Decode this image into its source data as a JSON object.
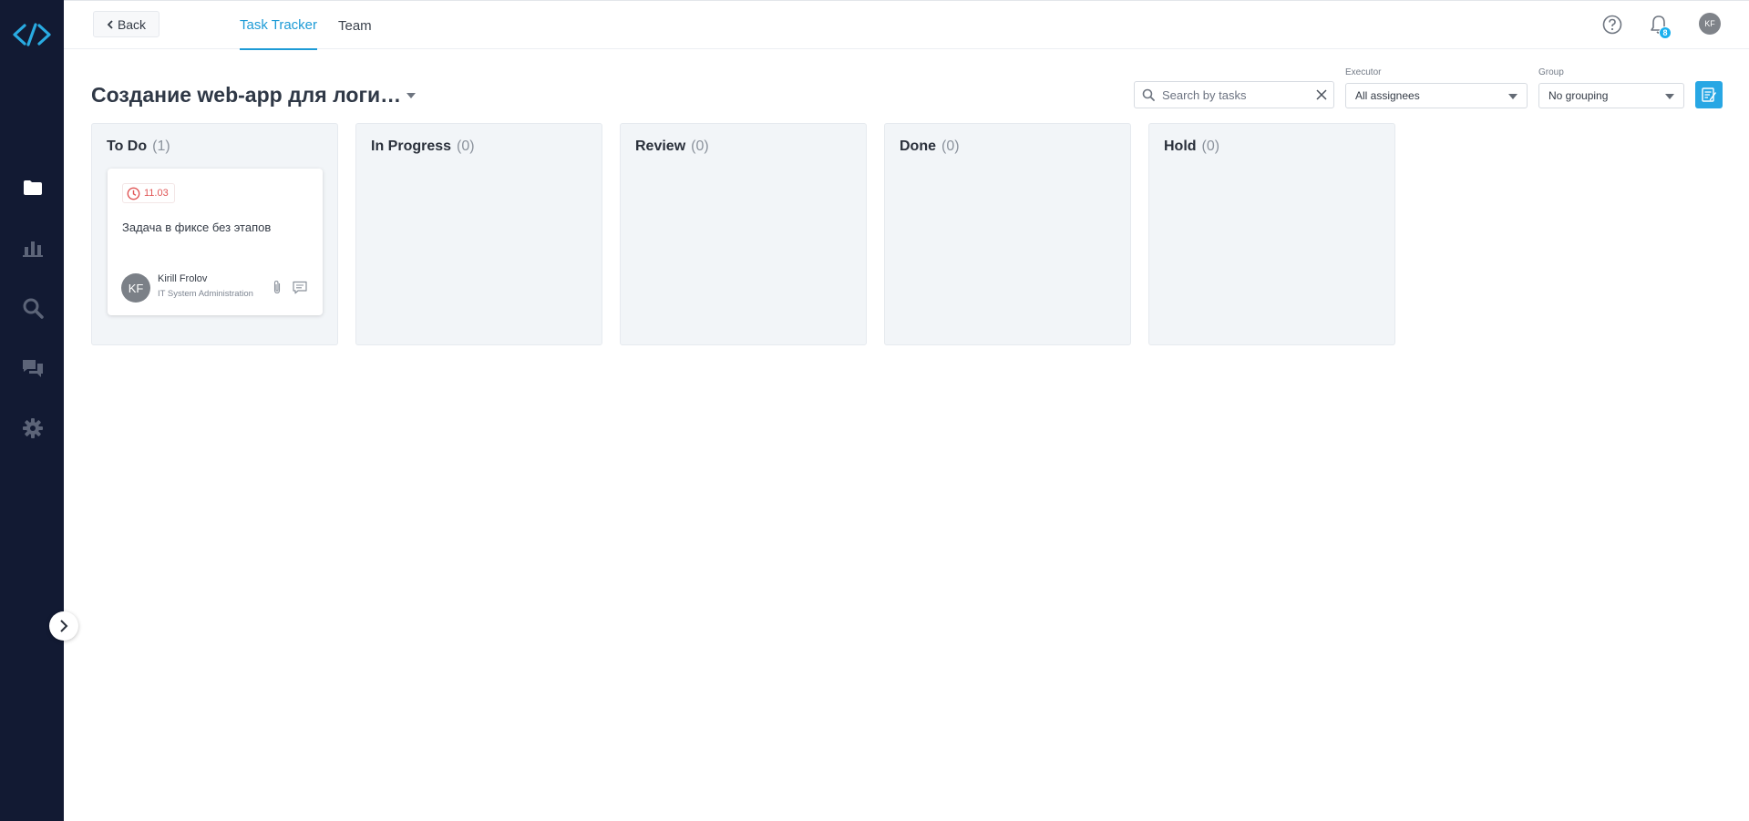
{
  "sidebar": {
    "icons": [
      "logo-icon",
      "folder-icon",
      "chart-icon",
      "search-icon",
      "chat-icon",
      "gear-icon"
    ],
    "expand_icon": "chevron-right-icon"
  },
  "header": {
    "back_label": "Back",
    "tabs": [
      {
        "label": "Task Tracker",
        "active": true
      },
      {
        "label": "Team",
        "active": false
      }
    ],
    "notification_count": "8",
    "user_initials": "KF"
  },
  "project": {
    "title": "Создание web-app для логи…"
  },
  "filters": {
    "search_placeholder": "Search by tasks",
    "executor_label": "Executor",
    "executor_value": "All assignees",
    "group_label": "Group",
    "group_value": "No grouping"
  },
  "board": {
    "columns": [
      {
        "name": "To Do",
        "count": "(1)"
      },
      {
        "name": "In Progress",
        "count": "(0)"
      },
      {
        "name": "Review",
        "count": "(0)"
      },
      {
        "name": "Done",
        "count": "(0)"
      },
      {
        "name": "Hold",
        "count": "(0)"
      }
    ],
    "card": {
      "due_date": "11.03",
      "title": "Задача в фиксе без этапов",
      "assignee_initials": "KF",
      "assignee_name": "Kirill Frolov",
      "assignee_dept": "IT System Administration"
    }
  },
  "colors": {
    "sidebar_bg": "#121a33",
    "accent": "#1d9bd6",
    "due_red": "#e05656"
  }
}
